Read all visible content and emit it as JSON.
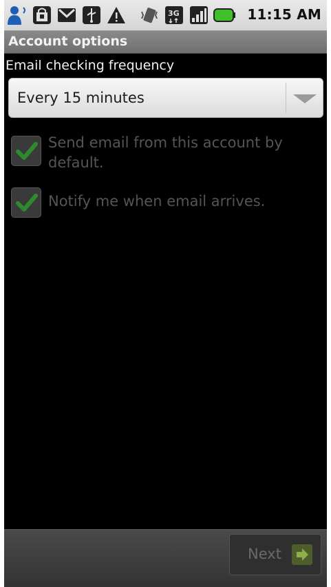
{
  "status_bar": {
    "time": "11:15 AM",
    "icons": [
      "person-icon",
      "shop-bag-icon",
      "gmail-icon",
      "usb-icon",
      "warning-icon",
      "vibrate-icon",
      "3g-icon",
      "signal-icon",
      "battery-icon"
    ],
    "network_label": "3G"
  },
  "title_bar": {
    "title": "Account options"
  },
  "frequency": {
    "label": "Email checking frequency",
    "selected": "Every 15 minutes"
  },
  "checkboxes": [
    {
      "label": "Send email from this account by default.",
      "checked": true
    },
    {
      "label": "Notify me when email arrives.",
      "checked": true
    }
  ],
  "bottom_bar": {
    "next_label": "Next"
  },
  "colors": {
    "background": "#000000",
    "title_bar": "#7a7a7a",
    "check_green": "#2f8a2f",
    "disabled_text": "#555555"
  }
}
